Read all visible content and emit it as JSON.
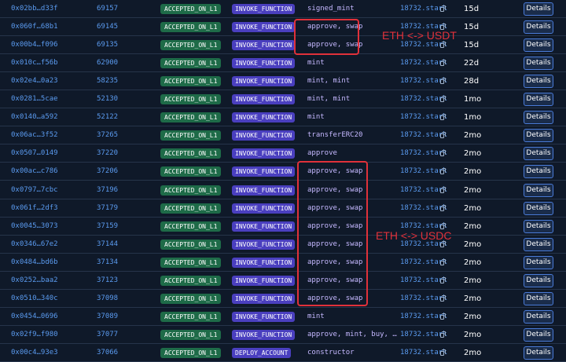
{
  "transactions": [
    {
      "hash": "0x02bb…d33f",
      "block": "69157",
      "status": "ACCEPTED_ON_L1",
      "type": "INVOKE_FUNCTION",
      "calls": "signed_mint",
      "account": "18732.stark",
      "age": "15d"
    },
    {
      "hash": "0x060f…68b1",
      "block": "69145",
      "status": "ACCEPTED_ON_L1",
      "type": "INVOKE_FUNCTION",
      "calls": "approve, swap",
      "account": "18732.stark",
      "age": "15d"
    },
    {
      "hash": "0x00b4…f096",
      "block": "69135",
      "status": "ACCEPTED_ON_L1",
      "type": "INVOKE_FUNCTION",
      "calls": "approve, swap",
      "account": "18732.stark",
      "age": "15d"
    },
    {
      "hash": "0x010c…f56b",
      "block": "62900",
      "status": "ACCEPTED_ON_L1",
      "type": "INVOKE_FUNCTION",
      "calls": "mint",
      "account": "18732.stark",
      "age": "22d"
    },
    {
      "hash": "0x02e4…0a23",
      "block": "58235",
      "status": "ACCEPTED_ON_L1",
      "type": "INVOKE_FUNCTION",
      "calls": "mint, mint",
      "account": "18732.stark",
      "age": "28d"
    },
    {
      "hash": "0x0281…5cae",
      "block": "52130",
      "status": "ACCEPTED_ON_L1",
      "type": "INVOKE_FUNCTION",
      "calls": "mint, mint",
      "account": "18732.stark",
      "age": "1mo"
    },
    {
      "hash": "0x0140…a592",
      "block": "52122",
      "status": "ACCEPTED_ON_L1",
      "type": "INVOKE_FUNCTION",
      "calls": "mint",
      "account": "18732.stark",
      "age": "1mo"
    },
    {
      "hash": "0x06ac…3f52",
      "block": "37265",
      "status": "ACCEPTED_ON_L1",
      "type": "INVOKE_FUNCTION",
      "calls": "transferERC20",
      "account": "18732.stark",
      "age": "2mo"
    },
    {
      "hash": "0x0507…0149",
      "block": "37220",
      "status": "ACCEPTED_ON_L1",
      "type": "INVOKE_FUNCTION",
      "calls": "approve",
      "account": "18732.stark",
      "age": "2mo"
    },
    {
      "hash": "0x00ac…c786",
      "block": "37206",
      "status": "ACCEPTED_ON_L1",
      "type": "INVOKE_FUNCTION",
      "calls": "approve, swap",
      "account": "18732.stark",
      "age": "2mo"
    },
    {
      "hash": "0x0797…7cbc",
      "block": "37196",
      "status": "ACCEPTED_ON_L1",
      "type": "INVOKE_FUNCTION",
      "calls": "approve, swap",
      "account": "18732.stark",
      "age": "2mo"
    },
    {
      "hash": "0x061f…2df3",
      "block": "37179",
      "status": "ACCEPTED_ON_L1",
      "type": "INVOKE_FUNCTION",
      "calls": "approve, swap",
      "account": "18732.stark",
      "age": "2mo"
    },
    {
      "hash": "0x0045…3073",
      "block": "37159",
      "status": "ACCEPTED_ON_L1",
      "type": "INVOKE_FUNCTION",
      "calls": "approve, swap",
      "account": "18732.stark",
      "age": "2mo"
    },
    {
      "hash": "0x0346…67e2",
      "block": "37144",
      "status": "ACCEPTED_ON_L1",
      "type": "INVOKE_FUNCTION",
      "calls": "approve, swap",
      "account": "18732.stark",
      "age": "2mo"
    },
    {
      "hash": "0x0484…bd6b",
      "block": "37134",
      "status": "ACCEPTED_ON_L1",
      "type": "INVOKE_FUNCTION",
      "calls": "approve, swap",
      "account": "18732.stark",
      "age": "2mo"
    },
    {
      "hash": "0x0252…baa2",
      "block": "37123",
      "status": "ACCEPTED_ON_L1",
      "type": "INVOKE_FUNCTION",
      "calls": "approve, swap",
      "account": "18732.stark",
      "age": "2mo"
    },
    {
      "hash": "0x0510…340c",
      "block": "37098",
      "status": "ACCEPTED_ON_L1",
      "type": "INVOKE_FUNCTION",
      "calls": "approve, swap",
      "account": "18732.stark",
      "age": "2mo"
    },
    {
      "hash": "0x0454…0696",
      "block": "37089",
      "status": "ACCEPTED_ON_L1",
      "type": "INVOKE_FUNCTION",
      "calls": "mint",
      "account": "18732.stark",
      "age": "2mo"
    },
    {
      "hash": "0x02f9…f980",
      "block": "37077",
      "status": "ACCEPTED_ON_L1",
      "type": "INVOKE_FUNCTION",
      "calls": "approve, mint, buy, …",
      "account": "18732.stark",
      "age": "2mo"
    },
    {
      "hash": "0x00c4…93e3",
      "block": "37066",
      "status": "ACCEPTED_ON_L1",
      "type": "DEPLOY_ACCOUNT",
      "calls": "constructor",
      "account": "18732.stark",
      "age": "2mo"
    }
  ],
  "details_label": "Details",
  "annotations": {
    "usdt_label": "ETH <-> USDT",
    "usdc_label": "ETH <-> USDC",
    "color": "#e0313a"
  },
  "colors": {
    "background": "#0f1929",
    "status_badge": "#1e6b48",
    "type_badge": "#4a3fbf",
    "link": "#5b9bf0"
  }
}
